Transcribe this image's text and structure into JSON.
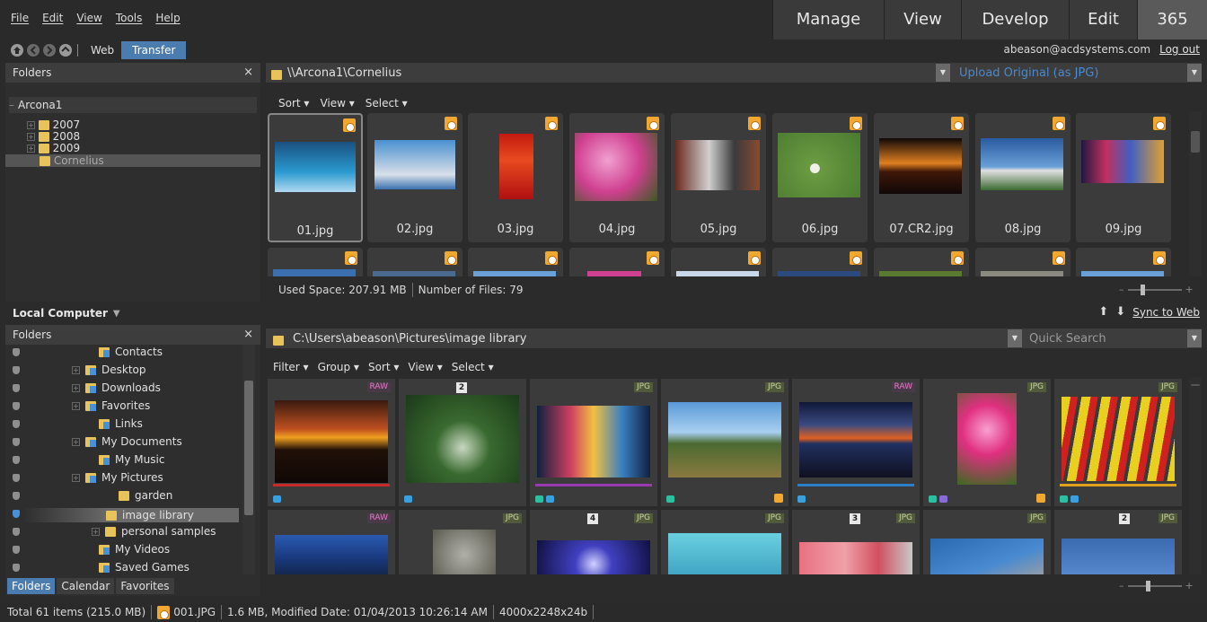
{
  "menu": [
    "File",
    "Edit",
    "View",
    "Tools",
    "Help"
  ],
  "modes": [
    {
      "label": "Manage",
      "active": false
    },
    {
      "label": "View",
      "active": false
    },
    {
      "label": "Develop",
      "active": false
    },
    {
      "label": "Edit",
      "active": false
    },
    {
      "label": "365",
      "active": true
    }
  ],
  "nav": {
    "web_tab": "Web",
    "transfer_tab": "Transfer",
    "account": "abeason@acdsystems.com",
    "logout": "Log out"
  },
  "remote": {
    "folders_title": "Folders",
    "tree_root": "Arcona1",
    "tree_items": [
      "2007",
      "2008",
      "2009",
      "Cornelius"
    ],
    "path": "\\\\Arcona1\\Cornelius",
    "upload_option": "Upload Original (as JPG)",
    "toolbar": [
      "Sort",
      "View",
      "Select"
    ],
    "files": [
      "01.jpg",
      "02.jpg",
      "03.jpg",
      "04.jpg",
      "05.jpg",
      "06.jpg",
      "07.CR2.jpg",
      "08.jpg",
      "09.jpg"
    ],
    "used_space": "Used Space: 207.91 MB",
    "file_count": "Number of Files: 79"
  },
  "local": {
    "title": "Local Computer",
    "sync": "Sync to Web",
    "folders_title": "Folders",
    "tree": [
      "Contacts",
      "Desktop",
      "Downloads",
      "Favorites",
      "Links",
      "My Documents",
      "My Music",
      "My Pictures",
      "garden",
      "image library",
      "personal samples",
      "My Videos",
      "Saved Games"
    ],
    "path": "C:\\Users\\abeason\\Pictures\\image library",
    "search_placeholder": "Quick Search",
    "toolbar": [
      "Filter",
      "Group",
      "Sort",
      "View",
      "Select"
    ],
    "row1_badges": [
      "RAW",
      "2",
      "JPG",
      "JPG",
      "RAW",
      "JPG",
      "JPG"
    ],
    "row2_badges": [
      "RAW",
      "JPG",
      "4",
      "JPG",
      "JPG",
      "3",
      "JPG",
      "JPG",
      "2",
      "JPG"
    ],
    "bottom_tabs": [
      "Folders",
      "Calendar",
      "Favorites"
    ]
  },
  "statusbar": {
    "total": "Total 61 items  (215.0 MB)",
    "file": "001.JPG",
    "info": "1.6 MB, Modified Date: 01/04/2013 10:26:14 AM",
    "dims": "4000x2248x24b"
  },
  "colors": {
    "accent": "#4a7cb0",
    "background": "#2b2b2b",
    "panel": "#3d3d3d",
    "upload_link": "#4a8ad0",
    "badge_orange": "#f0a830"
  }
}
